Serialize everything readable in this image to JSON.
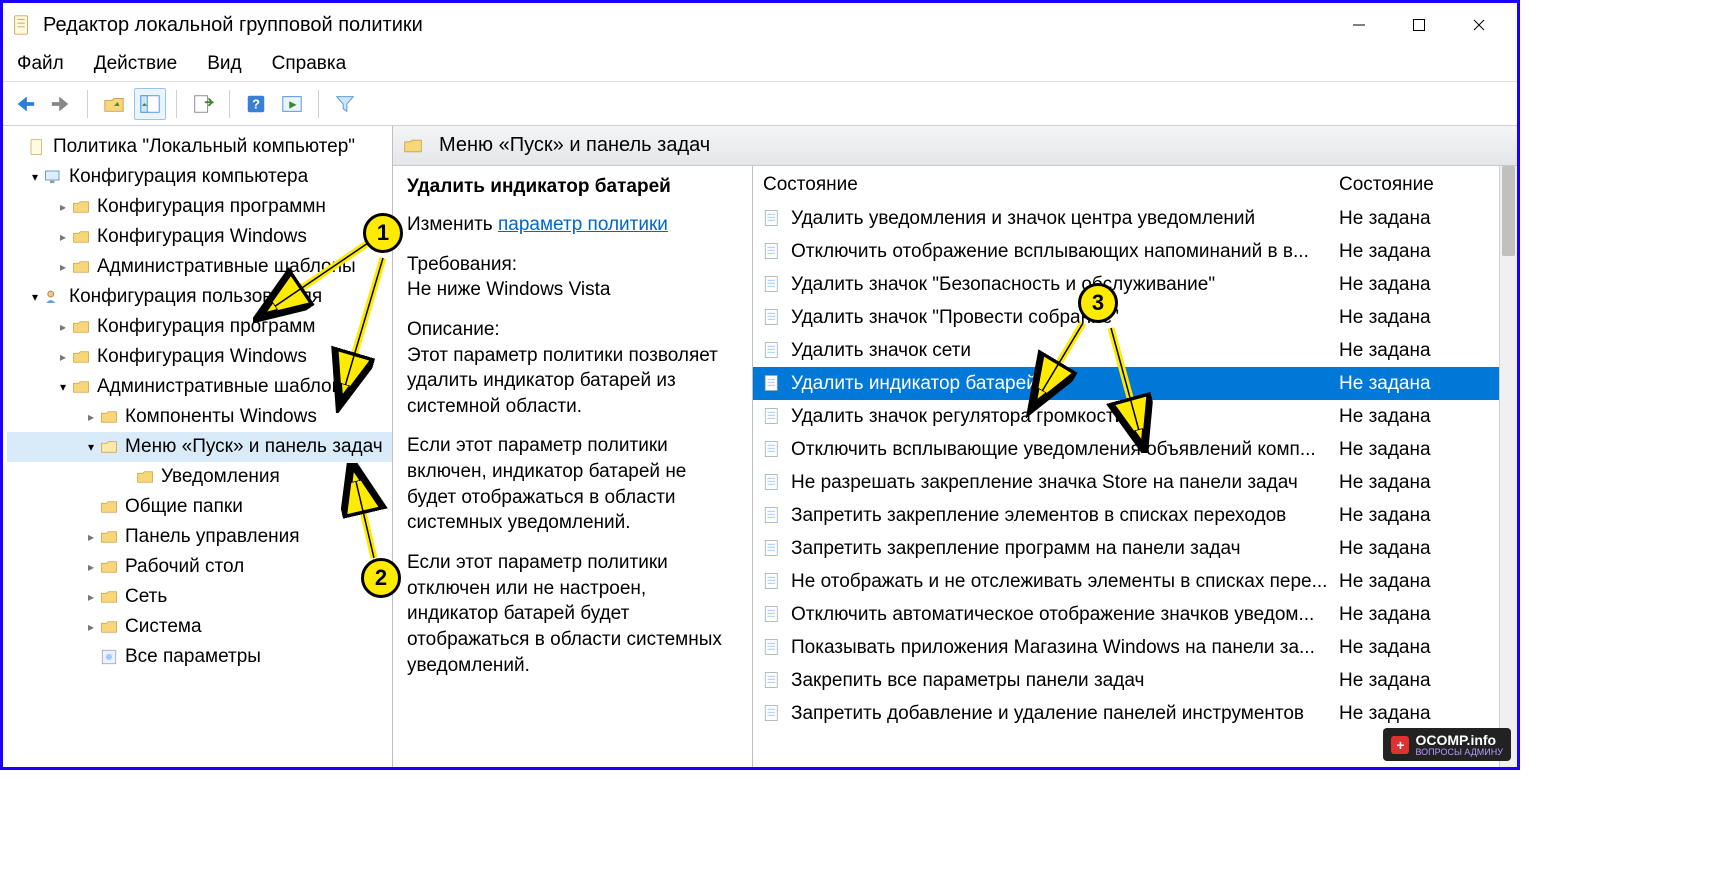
{
  "window": {
    "title": "Редактор локальной групповой политики"
  },
  "menubar": {
    "items": [
      "Файл",
      "Действие",
      "Вид",
      "Справка"
    ]
  },
  "tree": {
    "root": "Политика \"Локальный компьютер\"",
    "computer_config": "Конфигурация компьютера",
    "cc_soft": "Конфигурация программн",
    "cc_win": "Конфигурация Windows",
    "cc_admin": "Административные шаблоны",
    "user_config": "Конфигурация пользователя",
    "uc_soft": "Конфигурация программ",
    "uc_win": "Конфигурация Windows",
    "uc_admin": "Административные шаблоны",
    "uc_admin_comp": "Компоненты Windows",
    "uc_admin_start": "Меню «Пуск» и панель задач",
    "uc_admin_start_notif": "Уведомления",
    "uc_admin_shared": "Общие папки",
    "uc_admin_cpl": "Панель управления",
    "uc_admin_desktop": "Рабочий стол",
    "uc_admin_net": "Сеть",
    "uc_admin_sys": "Система",
    "uc_admin_all": "Все параметры"
  },
  "right": {
    "header": "Меню «Пуск» и панель задач",
    "policy_title": "Удалить индикатор батарей",
    "edit_label": "Изменить",
    "edit_link": "параметр политики",
    "req_label": "Требования:",
    "req_value": "Не ниже Windows Vista",
    "desc_label": "Описание:",
    "desc_p1": "Этот параметр политики позволяет удалить индикатор батарей из системной области.",
    "desc_p2": "Если этот параметр политики включен, индикатор батарей не будет отображаться в области системных уведомлений.",
    "desc_p3": "Если этот параметр политики отключен или не настроен, индикатор батарей будет отображаться в области системных уведомлений."
  },
  "list": {
    "col1": "Состояние",
    "col2": "Состояние",
    "default_state": "Не задана",
    "selected_state": "Не задана",
    "items": [
      "Удалить уведомления и значок центра уведомлений",
      "Отключить отображение всплывающих напоминаний в в...",
      "Удалить значок \"Безопасность и обслуживание\"",
      "Удалить значок \"Провести собрание\"",
      "Удалить значок сети",
      "Удалить индикатор батарей",
      "Удалить значок регулятора громкости",
      "Отключить всплывающие уведомления объявлений комп...",
      "Не разрешать закрепление значка Store на панели задач",
      "Запретить закрепление элементов в списках переходов",
      "Запретить закрепление программ на панели задач",
      "Не отображать и не отслеживать элементы в списках пере...",
      "Отключить автоматическое отображение значков уведом...",
      "Показывать приложения Магазина Windows на панели за...",
      "Закрепить все параметры панели задач",
      "Запретить добавление и удаление панелей инструментов"
    ],
    "selected_index": 5
  },
  "annotations": {
    "c1": "1",
    "c2": "2",
    "c3": "3"
  },
  "watermark": {
    "main": "OCOMP.info",
    "sub": "ВОПРОСЫ АДМИНУ"
  }
}
